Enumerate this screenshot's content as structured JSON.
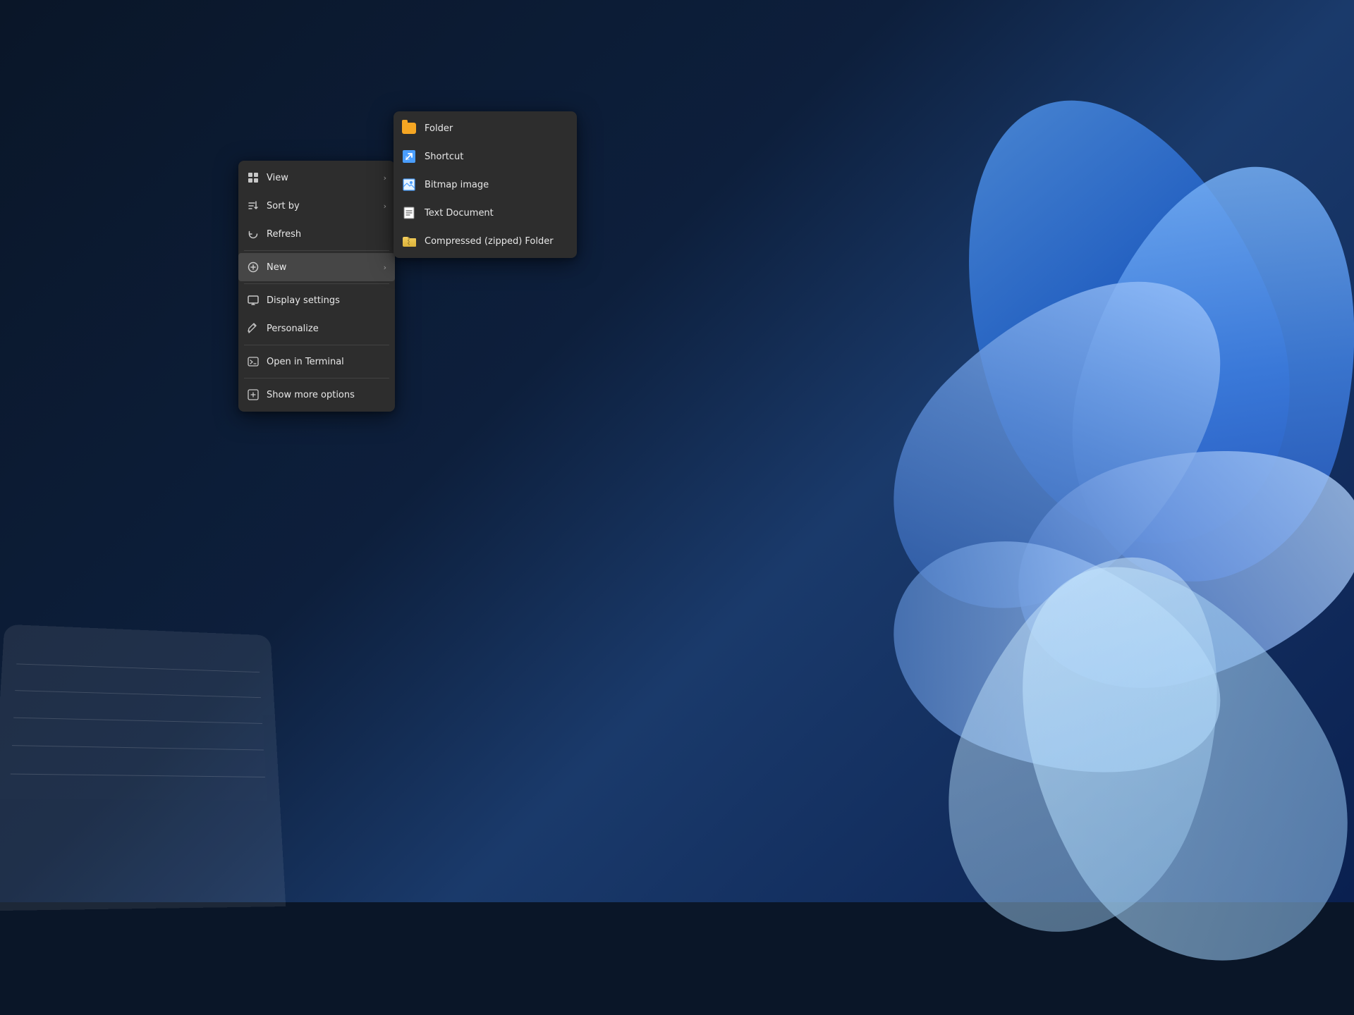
{
  "background": {
    "color": "#0a1628"
  },
  "contextMenu": {
    "items": [
      {
        "id": "view",
        "label": "View",
        "hasArrow": true
      },
      {
        "id": "sort-by",
        "label": "Sort by",
        "hasArrow": true
      },
      {
        "id": "refresh",
        "label": "Refresh",
        "hasArrow": false
      },
      {
        "id": "new",
        "label": "New",
        "hasArrow": true,
        "active": true
      },
      {
        "id": "display-settings",
        "label": "Display settings",
        "hasArrow": false
      },
      {
        "id": "personalize",
        "label": "Personalize",
        "hasArrow": false
      },
      {
        "id": "open-terminal",
        "label": "Open in Terminal",
        "hasArrow": false
      },
      {
        "id": "show-more",
        "label": "Show more options",
        "hasArrow": false
      }
    ]
  },
  "submenu": {
    "items": [
      {
        "id": "folder",
        "label": "Folder",
        "iconType": "folder"
      },
      {
        "id": "shortcut",
        "label": "Shortcut",
        "iconType": "shortcut"
      },
      {
        "id": "bitmap",
        "label": "Bitmap image",
        "iconType": "bitmap"
      },
      {
        "id": "text-doc",
        "label": "Text Document",
        "iconType": "textdoc"
      },
      {
        "id": "compressed",
        "label": "Compressed (zipped) Folder",
        "iconType": "zip"
      }
    ]
  }
}
